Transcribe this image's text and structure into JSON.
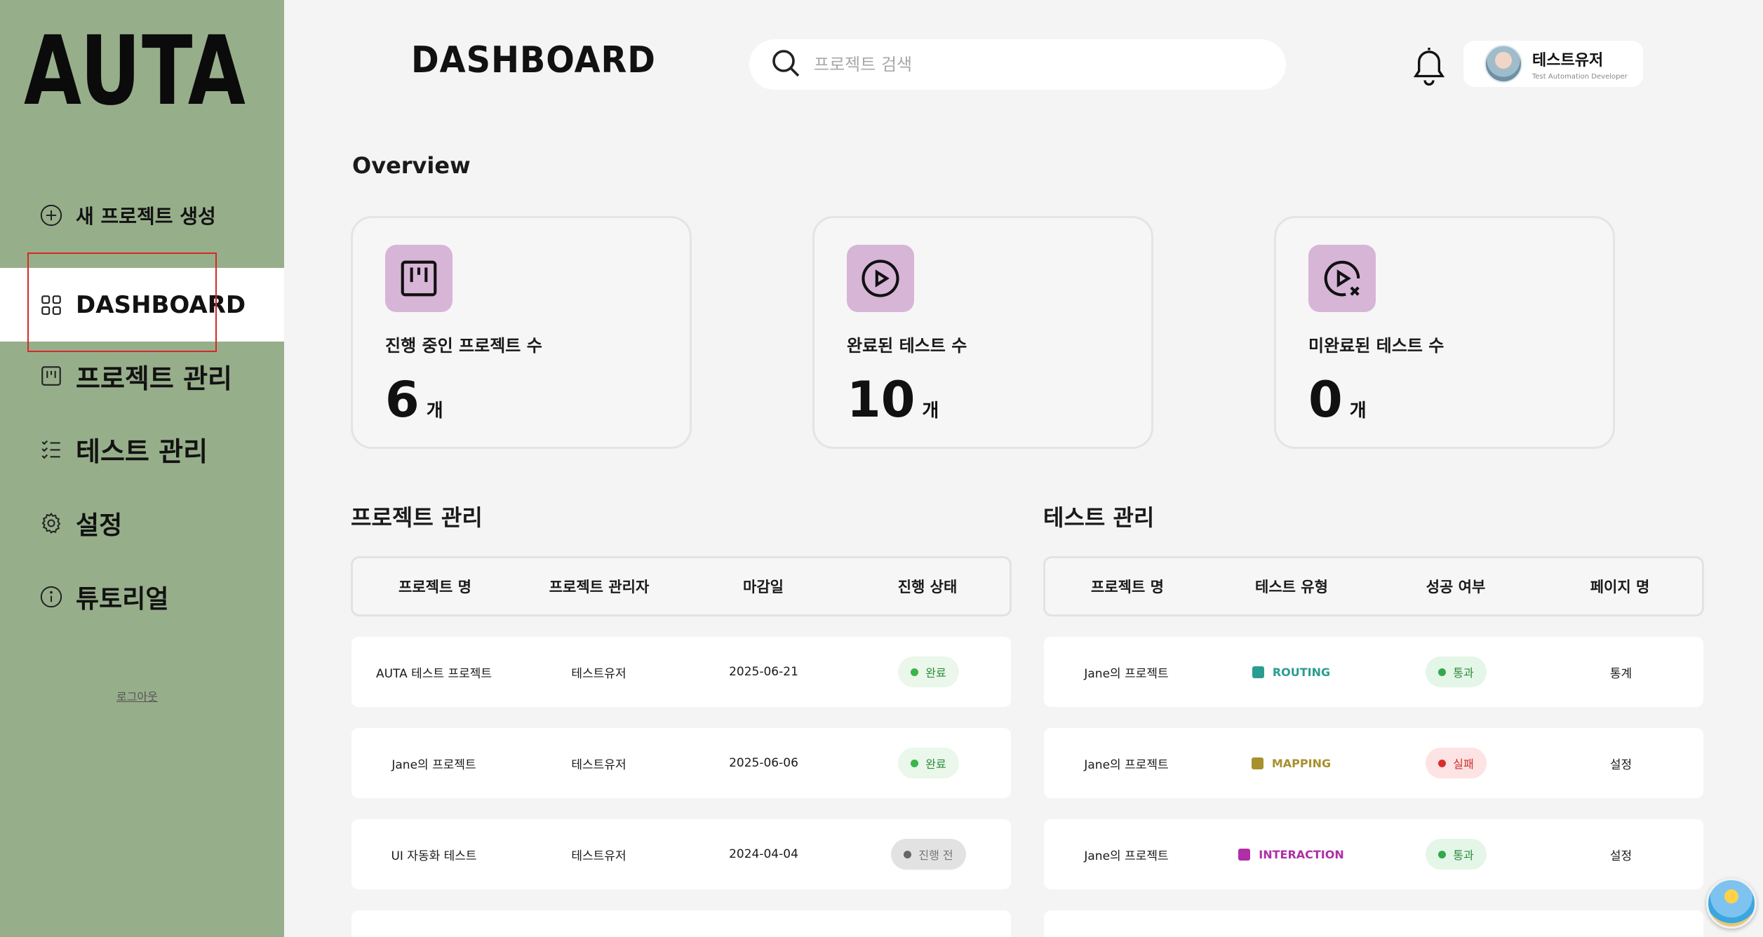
{
  "sidebar": {
    "logo": "AUTA",
    "new_project": "새 프로젝트 생성",
    "dashboard": "DASHBOARD",
    "project_manage": "프로젝트 관리",
    "test_manage": "테스트 관리",
    "settings": "설정",
    "tutorial": "튜토리얼",
    "logout": "로그아웃"
  },
  "header": {
    "title": "DASHBOARD",
    "search_placeholder": "프로젝트 검색",
    "user_name": "테스트유저",
    "user_role": "Test Automation Developer"
  },
  "overview": {
    "title": "Overview",
    "cards": [
      {
        "label": "진행 중인 프로젝트 수",
        "value": "6",
        "unit": "개"
      },
      {
        "label": "완료된 테스트 수",
        "value": "10",
        "unit": "개"
      },
      {
        "label": "미완료된 테스트 수",
        "value": "0",
        "unit": "개"
      }
    ]
  },
  "projects": {
    "title": "프로젝트 관리",
    "headers": [
      "프로젝트 명",
      "프로젝트 관리자",
      "마감일",
      "진행 상태"
    ],
    "rows": [
      {
        "name": "AUTA 테스트 프로젝트",
        "manager": "테스트유저",
        "deadline": "2025-06-21",
        "status": "완료"
      },
      {
        "name": "Jane의 프로젝트",
        "manager": "테스트유저",
        "deadline": "2025-06-06",
        "status": "완료"
      },
      {
        "name": "UI 자동화 테스트",
        "manager": "테스트유저",
        "deadline": "2024-04-04",
        "status": "진행 전"
      }
    ]
  },
  "tests": {
    "title": "테스트 관리",
    "headers": [
      "프로젝트 명",
      "테스트 유형",
      "성공 여부",
      "페이지 명"
    ],
    "rows": [
      {
        "project": "Jane의 프로젝트",
        "type": "ROUTING",
        "type_color": "#2a9d8f",
        "result": "통과",
        "page": "통계"
      },
      {
        "project": "Jane의 프로젝트",
        "type": "MAPPING",
        "type_color": "#a8902e",
        "result": "실패",
        "page": "설정"
      },
      {
        "project": "Jane의 프로젝트",
        "type": "INTERACTION",
        "type_color": "#b02ea8",
        "result": "통과",
        "page": "설정"
      }
    ]
  },
  "colors": {
    "sidebar_bg": "#97ae8b",
    "accent_icon_bg": "#d7b5d6",
    "highlight_border": "#d62828"
  }
}
